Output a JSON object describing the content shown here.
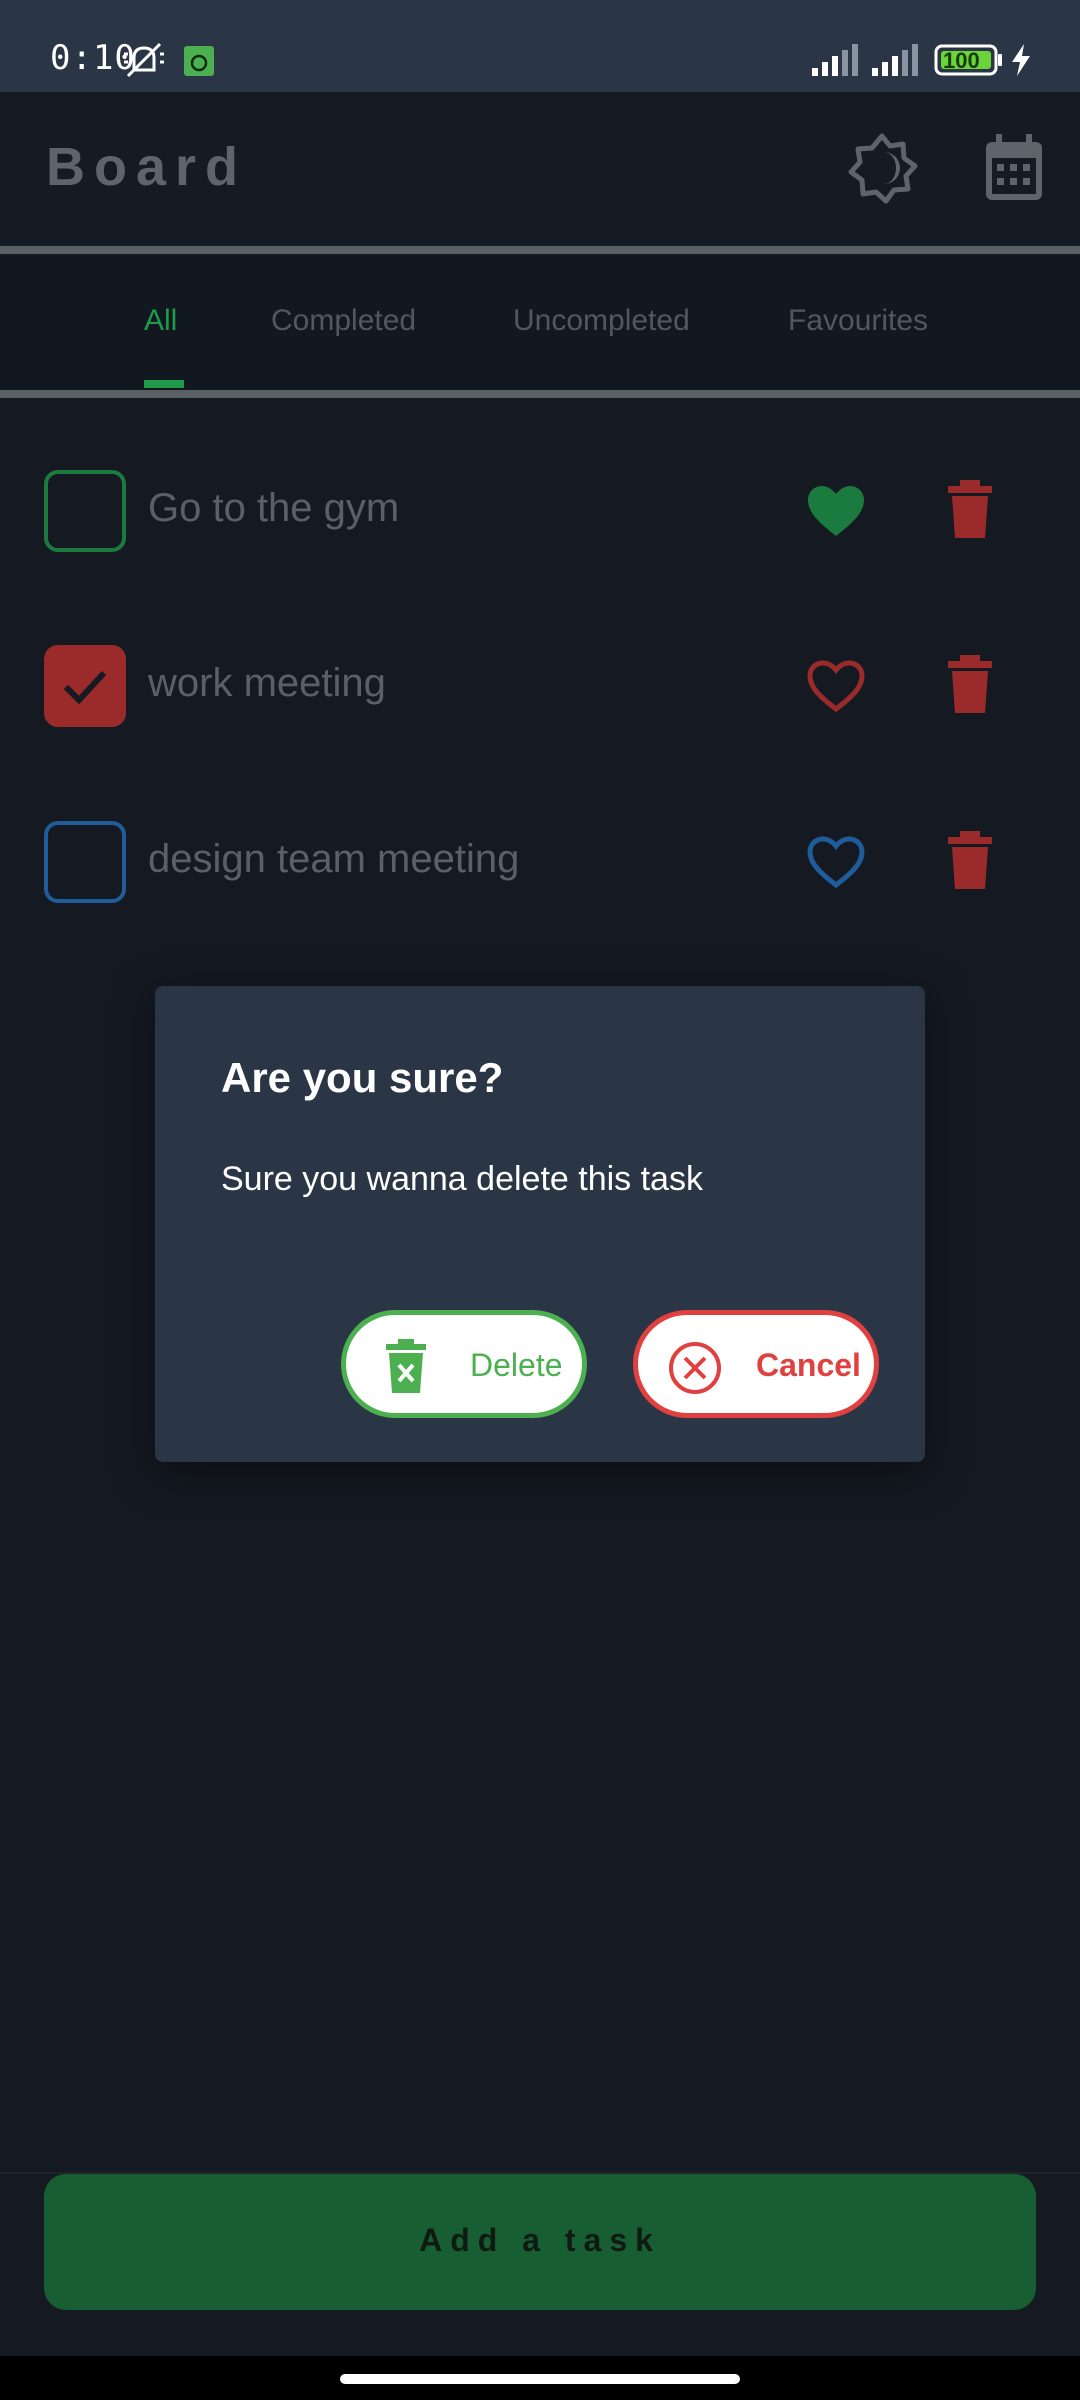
{
  "status_bar": {
    "time": "0:10",
    "battery": "100",
    "icons": [
      "mute-bell-icon",
      "android-app-icon",
      "signal-icon",
      "signal-icon",
      "battery-icon",
      "charging-icon"
    ]
  },
  "app_bar": {
    "title": "Board",
    "icons": [
      "theme-toggle-icon",
      "calendar-icon"
    ]
  },
  "tabs": [
    {
      "label": "All",
      "active": true
    },
    {
      "label": "Completed",
      "active": false
    },
    {
      "label": "Uncompleted",
      "active": false
    },
    {
      "label": "Favourites",
      "active": false
    }
  ],
  "tasks": [
    {
      "title": "Go to the gym",
      "checked": false,
      "favourite": true,
      "accent": "#1b7a3e"
    },
    {
      "title": "work meeting",
      "checked": true,
      "favourite": false,
      "accent": "#9b2b2b"
    },
    {
      "title": "design team meeting",
      "checked": false,
      "favourite": false,
      "accent": "#1f5c99"
    }
  ],
  "dialog": {
    "title": "Are you sure?",
    "message": "Sure you wanna delete this task",
    "delete_label": "Delete",
    "cancel_label": "Cancel"
  },
  "add_task_label": "Add a task",
  "colors": {
    "accent_green": "#1f9a4a",
    "delete_green": "#4caf50",
    "cancel_red": "#e0403f",
    "trash_red": "#9b2b2b",
    "background": "#151a22",
    "dialog_bg": "#2a3646"
  }
}
